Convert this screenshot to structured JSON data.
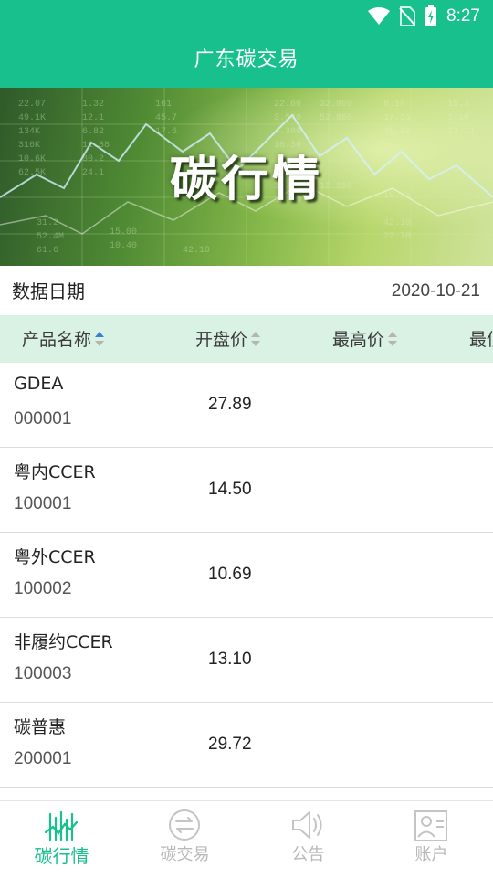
{
  "status_bar": {
    "time": "8:27"
  },
  "app_bar": {
    "title": "广东碳交易"
  },
  "banner": {
    "title": "碳行情"
  },
  "date_row": {
    "label": "数据日期",
    "value": "2020-10-21"
  },
  "table": {
    "columns": [
      {
        "label": "产品名称",
        "sort": "ascending"
      },
      {
        "label": "开盘价",
        "sort": "none"
      },
      {
        "label": "最高价",
        "sort": "none"
      },
      {
        "label": "最低价",
        "sort": "none"
      }
    ],
    "rows": [
      {
        "name": "GDEA",
        "code": "000001",
        "open": "27.89"
      },
      {
        "name": "粤内CCER",
        "code": "100001",
        "open": "14.50"
      },
      {
        "name": "粤外CCER",
        "code": "100002",
        "open": "10.69"
      },
      {
        "name": "非履约CCER",
        "code": "100003",
        "open": "13.10"
      },
      {
        "name": "碳普惠",
        "code": "200001",
        "open": "29.72"
      }
    ]
  },
  "bottom_nav": {
    "items": [
      {
        "label": "碳行情",
        "icon": "market-chart-icon",
        "active": true
      },
      {
        "label": "碳交易",
        "icon": "exchange-icon",
        "active": false
      },
      {
        "label": "公告",
        "icon": "speaker-icon",
        "active": false
      },
      {
        "label": "账户",
        "icon": "account-icon",
        "active": false
      }
    ]
  },
  "colors": {
    "brand": "#17c08c",
    "header_bg": "#d9f2e4",
    "sort_active": "#3b7dd8",
    "sort_inactive": "#b5b5b5",
    "nav_inactive": "#b9b9b9"
  }
}
